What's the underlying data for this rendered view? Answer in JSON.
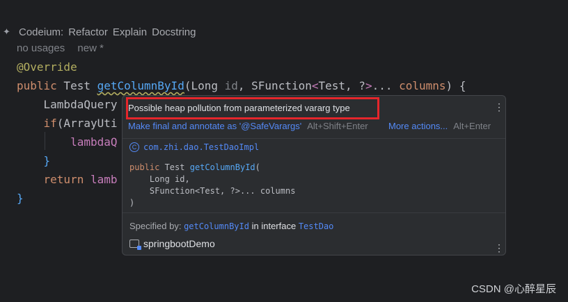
{
  "code_lens": {
    "prefix": "Codeium:",
    "actions": [
      "Refactor",
      "Explain",
      "Docstring"
    ]
  },
  "usages": {
    "no_usages": "no usages",
    "new": "new *"
  },
  "code": {
    "annotation": "@Override",
    "line2": {
      "kw_public": "public",
      "type": " Test ",
      "method": "getColumnById",
      "p_open": "(Long ",
      "p_id": "id",
      "p_mid": ", SFunction",
      "g_open": "<",
      "g_type": "Test, ",
      "g_q": "?",
      "g_close": ">",
      "p_dots": "... ",
      "p_cols": "columns",
      "p_close": ") {"
    },
    "line3": "    LambdaQuery",
    "line4_kw": "    if",
    "line4_rest": "(ArrayUti",
    "line5": "        lambdaQ",
    "line6": "    }",
    "line7_kw": "    return",
    "line7_rest": " lamb",
    "line8": "}"
  },
  "popup": {
    "warning": "Possible heap pollution from parameterized vararg type",
    "fix_action": "Make final and annotate as '@SafeVarargs'",
    "fix_shortcut": "Alt+Shift+Enter",
    "more_actions": "More actions...",
    "more_shortcut": "Alt+Enter",
    "class_icon": "C",
    "class_name": "com.zhi.dao.TestDaoImpl",
    "signature": {
      "kw": "public",
      "type": " Test ",
      "method": "getColumnById",
      "open": "(",
      "param1": "    Long id,",
      "param2": "    SFunction<Test, ?>... columns",
      "close": ")"
    },
    "specified_by_label": "Specified by:",
    "specified_method": "getColumnById",
    "in_interface": "in interface",
    "interface_name": "TestDao",
    "project": "springbootDemo"
  },
  "watermark": "CSDN @心醉星辰"
}
